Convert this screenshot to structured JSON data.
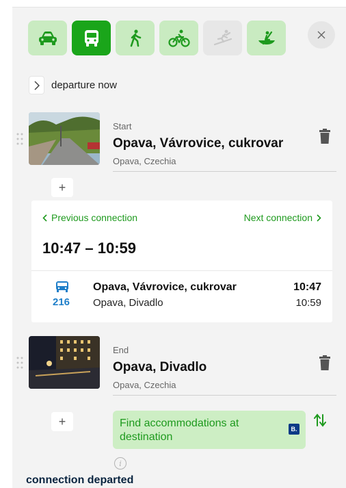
{
  "modes": [
    {
      "name": "car",
      "icon": "car-icon",
      "active": false,
      "disabled": false
    },
    {
      "name": "public-transport",
      "icon": "bus-icon",
      "active": true,
      "disabled": false
    },
    {
      "name": "walk",
      "icon": "walking-icon",
      "active": false,
      "disabled": false
    },
    {
      "name": "bike",
      "icon": "bicycle-icon",
      "active": false,
      "disabled": false
    },
    {
      "name": "ski",
      "icon": "skiing-icon",
      "active": false,
      "disabled": true
    },
    {
      "name": "boat",
      "icon": "canoe-icon",
      "active": false,
      "disabled": false
    }
  ],
  "departure": {
    "label": "departure now"
  },
  "start": {
    "caption": "Start",
    "name": "Opava, Vávrovice, cukrovar",
    "region": "Opava, Czechia"
  },
  "connection": {
    "prev_label": "Previous connection",
    "next_label": "Next connection",
    "time_range": "10:47 – 10:59",
    "legs": [
      {
        "line": "216",
        "from": "Opava, Vávrovice, cukrovar",
        "to": "Opava, Divadlo",
        "departure": "10:47",
        "arrival": "10:59"
      }
    ]
  },
  "end": {
    "caption": "End",
    "name": "Opava, Divadlo",
    "region": "Opava, Czechia"
  },
  "add_waypoint_label": "+",
  "accommodation": {
    "label": "Find accommodations at destination",
    "badge": "B."
  },
  "info_label": "i",
  "status": "connection departed",
  "colors": {
    "accent": "#1aa51a",
    "accent_light": "#c9ebc1",
    "link": "#1e9a1e",
    "line_blue": "#1f7fc9",
    "badge": "#0c3a86"
  }
}
